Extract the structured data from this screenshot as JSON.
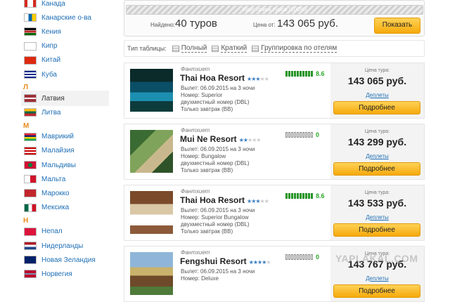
{
  "sidebar": {
    "groups": [
      {
        "letter": "",
        "items": [
          {
            "name": "Канада",
            "flag": "canada"
          },
          {
            "name": "Канарские о-ва",
            "flag": "canary"
          },
          {
            "name": "Кения",
            "flag": "kenya"
          },
          {
            "name": "Кипр",
            "flag": "cyprus"
          },
          {
            "name": "Китай",
            "flag": "china"
          },
          {
            "name": "Куба",
            "flag": "cuba"
          }
        ]
      },
      {
        "letter": "Л",
        "items": [
          {
            "name": "Латвия",
            "flag": "latvia",
            "selected": true
          },
          {
            "name": "Литва",
            "flag": "lithuania"
          }
        ]
      },
      {
        "letter": "М",
        "items": [
          {
            "name": "Маврикий",
            "flag": "mauritius"
          },
          {
            "name": "Малайзия",
            "flag": "malaysia"
          },
          {
            "name": "Мальдивы",
            "flag": "maldives"
          },
          {
            "name": "Мальта",
            "flag": "malta"
          },
          {
            "name": "Марокко",
            "flag": "morocco"
          },
          {
            "name": "Мексика",
            "flag": "mexico"
          }
        ]
      },
      {
        "letter": "Н",
        "items": [
          {
            "name": "Непал",
            "flag": "nepal"
          },
          {
            "name": "Нидерланды",
            "flag": "netherlands"
          },
          {
            "name": "Новая Зеландия",
            "flag": "new-zealand"
          },
          {
            "name": "Норвегия",
            "flag": "norway"
          }
        ]
      }
    ]
  },
  "summary": {
    "progress_text": "Идет поиск туров (100%)",
    "found_label": "Найдено:",
    "found_value": "40 туров",
    "price_label": "Цена от:",
    "price_value": "143 065 руб.",
    "show_button": "Показать"
  },
  "toolbar": {
    "label": "Тип таблицы:",
    "options": [
      "Полный",
      "Краткий",
      "Группировка по отелям"
    ]
  },
  "hotels": [
    {
      "operator": "Фантхиет",
      "name": "Thai Hoa Resort",
      "stars": 3,
      "departure": "Вылет: 06.09.2015 на 3 ночи",
      "room": "Номер: Superior",
      "occupancy": "двухместный номер (DBL)",
      "meal": "Только завтрак (BB)",
      "rating": 10,
      "rating_value": "8.6",
      "price_label": "Цена тура:",
      "price": "143 065 руб.",
      "more_link": "Деплеты",
      "button": "Подробнее"
    },
    {
      "operator": "Фантхиет",
      "name": "Mui Ne Resort",
      "stars": 2,
      "departure": "Вылет: 06.09.2015 на 3 ночи",
      "room": "Номер: Bungalow",
      "occupancy": "двухместный номер (DBL)",
      "meal": "Только завтрак (BB)",
      "rating": 0,
      "rating_value": "0",
      "price_label": "Цена тура:",
      "price": "143 299 руб.",
      "more_link": "Деплеты",
      "button": "Подробнее"
    },
    {
      "operator": "Фантхиет",
      "name": "Thai Hoa Resort",
      "stars": 3,
      "departure": "Вылет: 06.09.2015 на 3 ночи",
      "room": "Номер: Superior Bungalow",
      "occupancy": "двухместный номер (DBL)",
      "meal": "Только завтрак (BB)",
      "rating": 10,
      "rating_value": "8.6",
      "price_label": "Цена тура:",
      "price": "143 533 руб.",
      "more_link": "Деплеты",
      "button": "Подробнее"
    },
    {
      "operator": "Фантхиет",
      "name": "Fengshui Resort",
      "stars": 4,
      "departure": "Вылет: 06.09.2015 на 3 ночи",
      "room": "Номер: Deluxe",
      "occupancy": "",
      "meal": "",
      "rating": 0,
      "rating_value": "0",
      "price_label": "Цена тура:",
      "price": "143 767 руб.",
      "more_link": "Деплеты",
      "button": "Подробнее"
    }
  ],
  "watermark": "YAPLAKAL.COM"
}
